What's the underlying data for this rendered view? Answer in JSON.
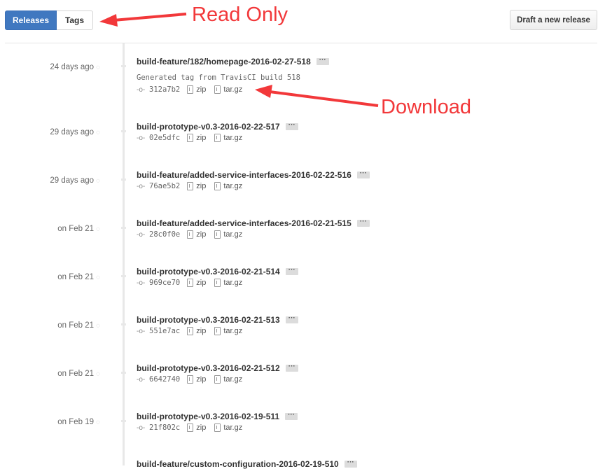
{
  "tabs": {
    "releases": "Releases",
    "tags": "Tags"
  },
  "draft_button": "Draft a new release",
  "annotations": {
    "read_only": "Read Only",
    "download": "Download"
  },
  "accent_color": "#4078c0",
  "annotation_color": "#f2383a",
  "releases": [
    {
      "date": "24 days ago",
      "title": "build-feature/182/homepage-2016-02-27-518",
      "description": "Generated tag from TravisCI build 518",
      "sha": "312a7b2",
      "zip": "zip",
      "targz": "tar.gz"
    },
    {
      "date": "29 days ago",
      "title": "build-prototype-v0.3-2016-02-22-517",
      "sha": "02e5dfc",
      "zip": "zip",
      "targz": "tar.gz"
    },
    {
      "date": "29 days ago",
      "title": "build-feature/added-service-interfaces-2016-02-22-516",
      "sha": "76ae5b2",
      "zip": "zip",
      "targz": "tar.gz"
    },
    {
      "date": "on Feb 21",
      "title": "build-feature/added-service-interfaces-2016-02-21-515",
      "sha": "28c0f0e",
      "zip": "zip",
      "targz": "tar.gz"
    },
    {
      "date": "on Feb 21",
      "title": "build-prototype-v0.3-2016-02-21-514",
      "sha": "969ce70",
      "zip": "zip",
      "targz": "tar.gz"
    },
    {
      "date": "on Feb 21",
      "title": "build-prototype-v0.3-2016-02-21-513",
      "sha": "551e7ac",
      "zip": "zip",
      "targz": "tar.gz"
    },
    {
      "date": "on Feb 21",
      "title": "build-prototype-v0.3-2016-02-21-512",
      "sha": "6642740",
      "zip": "zip",
      "targz": "tar.gz"
    },
    {
      "date": "on Feb 19",
      "title": "build-prototype-v0.3-2016-02-19-511",
      "sha": "21f802c",
      "zip": "zip",
      "targz": "tar.gz"
    },
    {
      "title": "build-feature/custom-configuration-2016-02-19-510"
    }
  ]
}
